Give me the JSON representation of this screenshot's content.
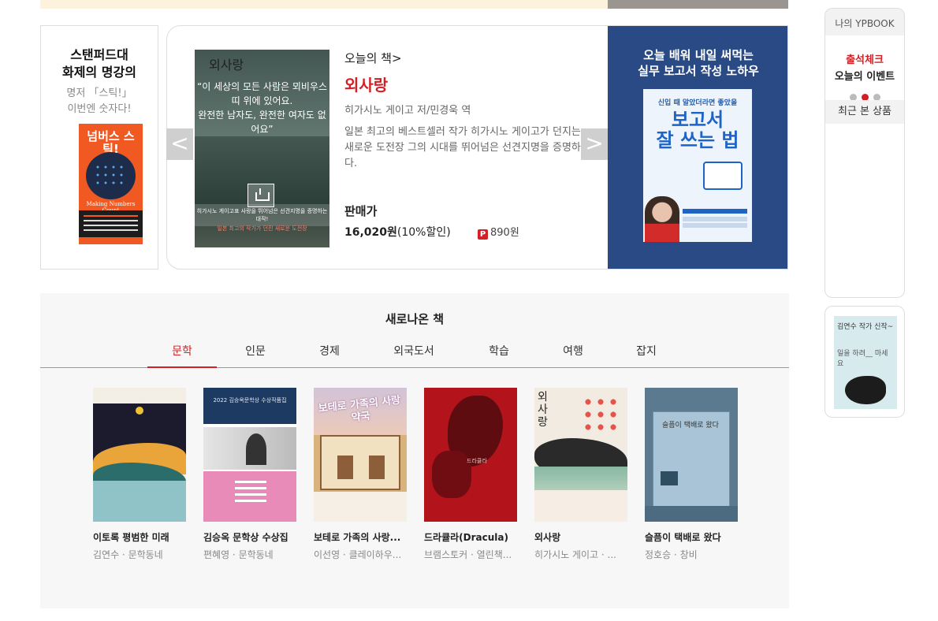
{
  "left_promo": {
    "title": "스탠퍼드대\n화제의 명강의",
    "subtitle": "명저 「스틱!」\n이번엔 숫자다!",
    "book_title": "넘버스 스틱!",
    "book_en": "Making Numbers Count"
  },
  "featured": {
    "cover_title": "외사랑",
    "cover_quote": "“이 세상의 모든 사람은 뫼비우스 띠 위에 있어요.\n완전한 남자도, 완전한 여자도 없어요”",
    "cover_strip1": "히가시노 게이고표 사랑을 뛰어넘은 선견지명을 증명하는 대작!",
    "cover_strip2": "일본 최고의 작가가 던진 새로운 도전장",
    "label": "오늘의 책>",
    "title": "외사랑",
    "author": "히가시노 게이고 저/민경욱 역",
    "description": "일본 최고의 베스트셀러 작가 히가시노 게이고가 던지는 새로운 도전장 그의 시대를 뛰어넘은 선견지명을 증명하다.",
    "price_label": "판매가",
    "price": "16,020원",
    "discount": "(10%할인)",
    "point_icon": "P",
    "point": "890원",
    "prev_arrow": "<",
    "next_arrow": ">"
  },
  "ad": {
    "text": "오늘 배워 내일 써먹는\n실무 보고서 작성 노하우",
    "book_tag": "신입 때 알았더라면 좋았을",
    "book_title": "보고서\n잘 쓰는 법"
  },
  "sidebar": {
    "my_label": "나의 YPBOOK",
    "attendance": "출석체크",
    "event": "오늘의 이벤트",
    "recent": "최근 본 상품",
    "promo_tag": "김연수 작가 신작~",
    "promo_title": "일을 하려__ 마세요"
  },
  "new_books": {
    "title": "새로나온 책",
    "tabs": [
      "문학",
      "인문",
      "경제",
      "외국도서",
      "학습",
      "여행",
      "잡지"
    ],
    "active_tab": 0,
    "items": [
      {
        "title": "이토록 평범한 미래",
        "meta": "김연수 · 문학동네",
        "cover_text": "이토록 평범한 미래"
      },
      {
        "title": "김승옥 문학상 수상집",
        "meta": "편혜영 · 문학동네",
        "cover_text": "2022 김승옥문학상 수상작품집"
      },
      {
        "title": "보테로 가족의 사랑...",
        "meta": "이선영 · 클레이하우...",
        "cover_text": "보테로 가족의 사랑 약국"
      },
      {
        "title": "드라큘라(Dracula)",
        "meta": "브램스토커 · 열린책...",
        "cover_text": "드라큘라"
      },
      {
        "title": "외사랑",
        "meta": "히가시노 게이고 · ...",
        "cover_text": "외사랑"
      },
      {
        "title": "슬픔이 택배로 왔다",
        "meta": "정호승 · 창비",
        "cover_text": "슬픔이 택배로 왔다"
      }
    ]
  },
  "colors": {
    "accent": "#d31f26",
    "ad_background": "#2a4a86",
    "section_background": "#f7f7f7"
  }
}
